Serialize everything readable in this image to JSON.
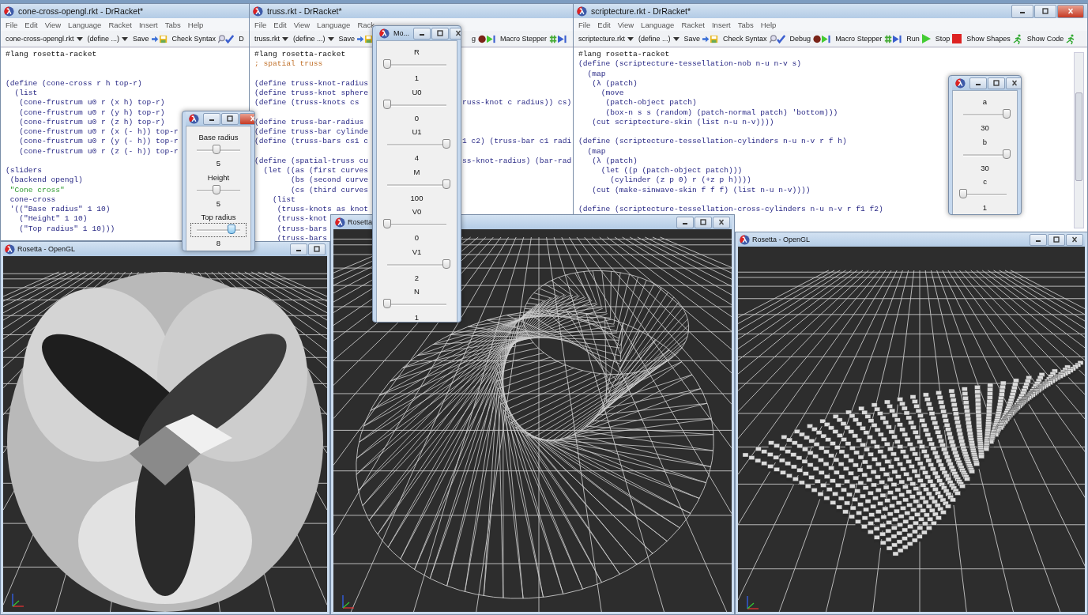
{
  "editors": [
    {
      "title": "cone-cross-opengl.rkt - DrRacket*",
      "menu": [
        "File",
        "Edit",
        "View",
        "Language",
        "Racket",
        "Insert",
        "Tabs",
        "Help"
      ],
      "toolbar": [
        {
          "kind": "file",
          "label": "cone-cross-opengl.rkt"
        },
        {
          "kind": "define",
          "label": "(define ...)"
        },
        {
          "kind": "save",
          "label": "Save"
        },
        {
          "kind": "check",
          "label": "Check Syntax"
        },
        {
          "kind": "text",
          "label": "D"
        }
      ],
      "code": [
        {
          "kind": "lang",
          "text": "#lang rosetta-racket"
        },
        {
          "kind": "blank"
        },
        {
          "kind": "blank"
        },
        {
          "kind": "code",
          "text": "(define (cone-cross r h top-r)"
        },
        {
          "kind": "code",
          "text": "  (list"
        },
        {
          "kind": "code",
          "text": "   (cone-frustrum u0 r (x h) top-r)"
        },
        {
          "kind": "code",
          "text": "   (cone-frustrum u0 r (y h) top-r)"
        },
        {
          "kind": "code",
          "text": "   (cone-frustrum u0 r (z h) top-r)"
        },
        {
          "kind": "code",
          "text": "   (cone-frustrum u0 r (x (- h)) top-r"
        },
        {
          "kind": "code",
          "text": "   (cone-frustrum u0 r (y (- h)) top-r"
        },
        {
          "kind": "code",
          "text": "   (cone-frustrum u0 r (z (- h)) top-r"
        },
        {
          "kind": "blank"
        },
        {
          "kind": "code",
          "text": "(sliders"
        },
        {
          "kind": "code",
          "text": " (backend opengl)"
        },
        {
          "kind": "string",
          "text": " \"Cone cross\""
        },
        {
          "kind": "code",
          "text": " cone-cross"
        },
        {
          "kind": "code",
          "text": " '((\"Base radius\" 1 10)"
        },
        {
          "kind": "code",
          "text": "   (\"Height\" 1 10)"
        },
        {
          "kind": "code",
          "text": "   (\"Top radius\" 1 10)))"
        }
      ]
    },
    {
      "title": "truss.rkt - DrRacket*",
      "menu": [
        "File",
        "Edit",
        "View",
        "Language",
        "Rack"
      ],
      "toolbar": [
        {
          "kind": "file",
          "label": "truss.rkt"
        },
        {
          "kind": "define",
          "label": "(define ...)"
        },
        {
          "kind": "save",
          "label": "Save"
        },
        {
          "kind": "debug",
          "label": "g"
        },
        {
          "kind": "macro",
          "label": "Macro Stepper"
        }
      ],
      "code": [
        {
          "kind": "lang",
          "text": "#lang rosetta-racket"
        },
        {
          "kind": "comment",
          "text": "; spatial truss"
        },
        {
          "kind": "blank"
        },
        {
          "kind": "code",
          "text": "(define truss-knot-radius"
        },
        {
          "kind": "code",
          "text": "(define truss-knot sphere"
        },
        {
          "kind": "code",
          "text": "(define (truss-knots cs",
          "right": "russ-knot c radius)) cs)"
        },
        {
          "kind": "blank"
        },
        {
          "kind": "code",
          "text": "(define truss-bar-radius"
        },
        {
          "kind": "code",
          "text": "(define truss-bar cylinde"
        },
        {
          "kind": "code",
          "text": "(define (truss-bars cs1 c",
          "right": "1 c2) (truss-bar c1 radi"
        },
        {
          "kind": "blank"
        },
        {
          "kind": "code",
          "text": "(define (spatial-truss cu",
          "right": "ss-knot-radius) (bar-rad"
        },
        {
          "kind": "code",
          "text": "  (let ((as (first curves"
        },
        {
          "kind": "code",
          "text": "        (bs (second curve"
        },
        {
          "kind": "code",
          "text": "        (cs (third curves"
        },
        {
          "kind": "code",
          "text": "    (list"
        },
        {
          "kind": "code",
          "text": "     (truss-knots as knot"
        },
        {
          "kind": "code",
          "text": "     (truss-knot"
        },
        {
          "kind": "code",
          "text": "     (truss-bars"
        },
        {
          "kind": "code",
          "text": "     (truss-bars"
        }
      ]
    },
    {
      "title": "scriptecture.rkt - DrRacket*",
      "menu": [
        "File",
        "Edit",
        "View",
        "Language",
        "Racket",
        "Insert",
        "Tabs",
        "Help"
      ],
      "toolbar": [
        {
          "kind": "file",
          "label": "scriptecture.rkt"
        },
        {
          "kind": "define",
          "label": "(define ...)"
        },
        {
          "kind": "save",
          "label": "Save"
        },
        {
          "kind": "check",
          "label": "Check Syntax"
        },
        {
          "kind": "debug",
          "label": "Debug"
        },
        {
          "kind": "macro",
          "label": "Macro Stepper"
        },
        {
          "kind": "run",
          "label": "Run"
        },
        {
          "kind": "stop",
          "label": "Stop"
        },
        {
          "kind": "runner",
          "label": "Show Shapes"
        },
        {
          "kind": "runner",
          "label": "Show Code"
        }
      ],
      "code": [
        {
          "kind": "lang",
          "text": "#lang rosetta-racket"
        },
        {
          "kind": "code",
          "text": "(define (scriptecture-tessellation-nob n-u n-v s)"
        },
        {
          "kind": "code",
          "text": "  (map"
        },
        {
          "kind": "code",
          "text": "   (λ (patch)"
        },
        {
          "kind": "code",
          "text": "     (move"
        },
        {
          "kind": "code",
          "text": "      (patch-object patch)"
        },
        {
          "kind": "code",
          "text": "      (box-n s s (random) (patch-normal patch) 'bottom)))"
        },
        {
          "kind": "code",
          "text": "   (cut scriptecture-skin (list n-u n-v))))"
        },
        {
          "kind": "blank"
        },
        {
          "kind": "code",
          "text": "(define (scriptecture-tessellation-cylinders n-u n-v r f h)"
        },
        {
          "kind": "code",
          "text": "  (map"
        },
        {
          "kind": "code",
          "text": "   (λ (patch)"
        },
        {
          "kind": "code",
          "text": "     (let ((p (patch-object patch)))"
        },
        {
          "kind": "code",
          "text": "       (cylinder (z p 0) r (+z p h))))"
        },
        {
          "kind": "code",
          "text": "   (cut (make-sinwave-skin f f f) (list n-u n-v))))"
        },
        {
          "kind": "blank"
        },
        {
          "kind": "code",
          "text": "(define (scriptecture-tessellation-cross-cylinders n-u n-v r f1 f2)"
        }
      ]
    }
  ],
  "viewers": [
    {
      "title": "Rosetta - OpenGL",
      "kind": "cone"
    },
    {
      "title": "Rosetta",
      "kind": "truss"
    },
    {
      "title": "Rosetta - OpenGL",
      "kind": "cubes"
    }
  ],
  "dialogs": [
    {
      "sliders": [
        {
          "label": "Base radius",
          "level": 0.45,
          "value": "5",
          "focused": false
        },
        {
          "label": "Height",
          "level": 0.45,
          "value": "5",
          "focused": false
        },
        {
          "label": "Top radius",
          "level": 0.8,
          "value": "8",
          "focused": true
        }
      ]
    },
    {
      "title": "Mo...",
      "sliders": [
        {
          "label": "R",
          "level": 0,
          "value": "1",
          "focused": false
        },
        {
          "label": "U0",
          "level": 0,
          "value": "0",
          "focused": false
        },
        {
          "label": "U1",
          "level": 1,
          "value": "4",
          "focused": false
        },
        {
          "label": "M",
          "level": 1,
          "value": "100",
          "focused": false
        },
        {
          "label": "V0",
          "level": 0,
          "value": "0",
          "focused": false
        },
        {
          "label": "V1",
          "level": 1,
          "value": "2",
          "focused": false
        },
        {
          "label": "N",
          "level": 0,
          "value": "1",
          "focused": false
        }
      ]
    },
    {
      "sliders": [
        {
          "label": "a",
          "level": 1,
          "value": "30",
          "focused": false
        },
        {
          "label": "b",
          "level": 1,
          "value": "30",
          "focused": false
        },
        {
          "label": "c",
          "level": 0,
          "value": "1",
          "focused": false
        }
      ]
    }
  ]
}
